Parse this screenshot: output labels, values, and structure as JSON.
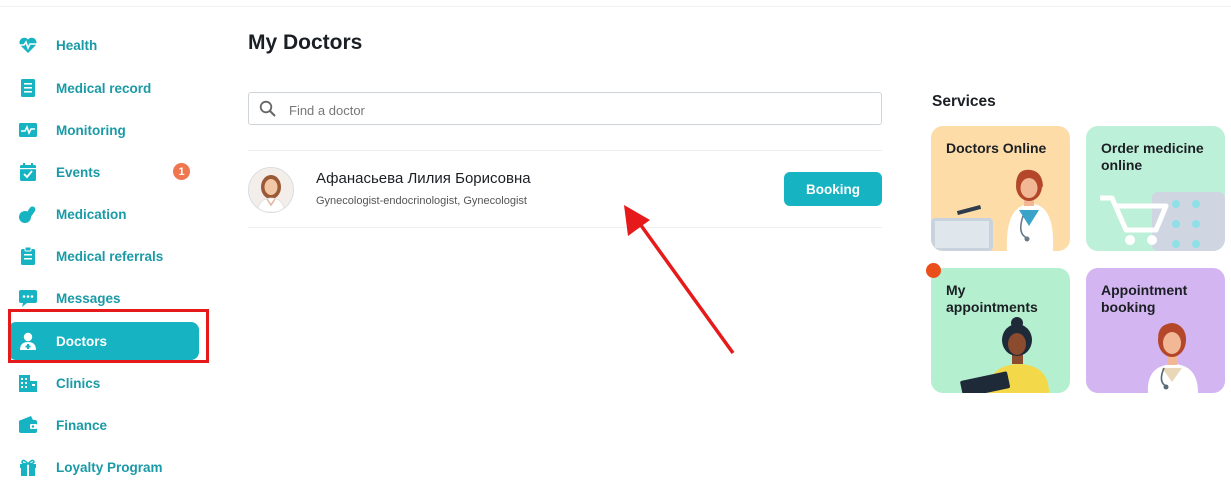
{
  "sidebar": {
    "items": [
      {
        "label": "Health",
        "icon": "heart-pulse-icon"
      },
      {
        "label": "Medical record",
        "icon": "document-list-icon"
      },
      {
        "label": "Monitoring",
        "icon": "monitor-chart-icon"
      },
      {
        "label": "Events",
        "icon": "calendar-check-icon",
        "badge": "1"
      },
      {
        "label": "Medication",
        "icon": "pills-icon"
      },
      {
        "label": "Medical referrals",
        "icon": "clipboard-icon"
      },
      {
        "label": "Messages",
        "icon": "chat-icon"
      },
      {
        "label": "Doctors",
        "icon": "doctor-icon",
        "active": true
      },
      {
        "label": "Clinics",
        "icon": "building-icon"
      },
      {
        "label": "Finance",
        "icon": "wallet-icon"
      },
      {
        "label": "Loyalty Program",
        "icon": "gift-icon"
      }
    ]
  },
  "main": {
    "title": "My Doctors",
    "search": {
      "placeholder": "Find a doctor",
      "value": ""
    },
    "doctors": [
      {
        "name": "Афанасьева Лилия Борисовна",
        "specialty": "Gynecologist-endocrinologist, Gynecologist",
        "action_label": "Booking"
      }
    ]
  },
  "services": {
    "title": "Services",
    "cards": [
      {
        "title": "Doctors Online",
        "color": "#fddca8"
      },
      {
        "title": "Order medicine online",
        "color": "#bdf0d8"
      },
      {
        "title": "My appointments",
        "color": "#b4f0d0",
        "notification": true
      },
      {
        "title": "Appointment booking",
        "color": "#d3b5f1"
      }
    ]
  },
  "colors": {
    "accent": "#16b3c3",
    "sidebar_text": "#1a9aa6",
    "badge": "#f0764f",
    "annotation_red": "#e61a1a"
  }
}
